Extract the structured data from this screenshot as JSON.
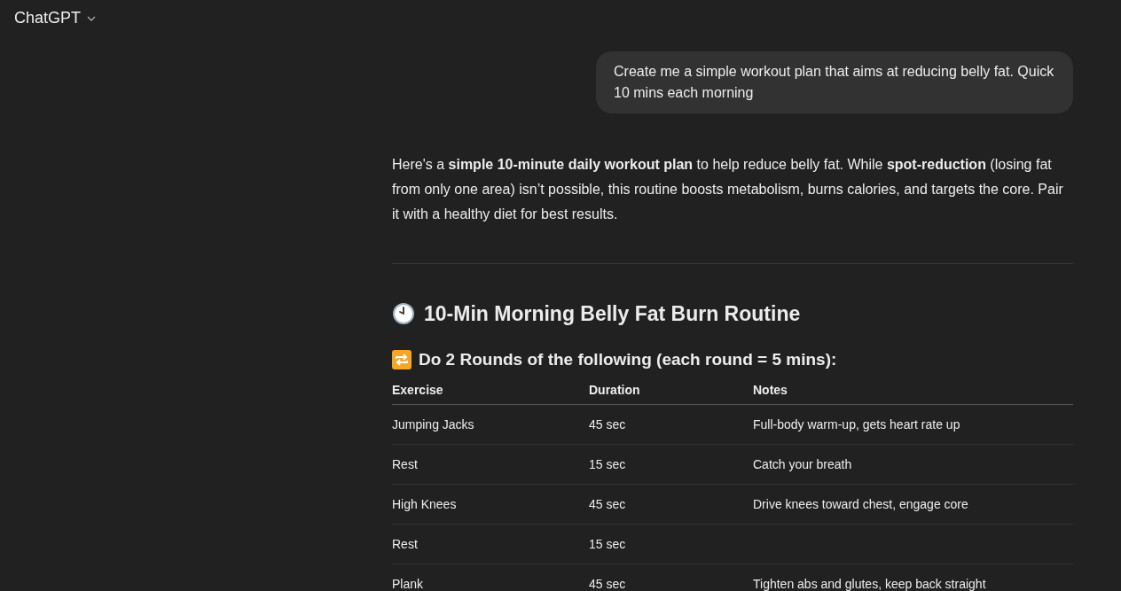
{
  "header": {
    "title": "ChatGPT"
  },
  "user_message": "Create me a simple workout plan that aims at reducing belly fat. Quick 10 mins each morning",
  "reply": {
    "intro": "Here's a **simple 10-minute daily workout plan** to help reduce belly fat. While **spot-reduction** (losing fat from only one area) isn’t possible, this routine boosts metabolism, burns calories, and targets the core. Pair it with a healthy diet for best results.",
    "heading": "10-Min Morning Belly Fat Burn Routine",
    "subheading": "Do 2 Rounds of the following (each round = 5 mins):",
    "table": {
      "columns": [
        "Exercise",
        "Duration",
        "Notes"
      ],
      "rows": [
        [
          "Jumping Jacks",
          "45 sec",
          "Full-body warm-up, gets heart rate up"
        ],
        [
          "Rest",
          "15 sec",
          "Catch your breath"
        ],
        [
          "High Knees",
          "45 sec",
          "Drive knees toward chest, engage core"
        ],
        [
          "Rest",
          "15 sec",
          ""
        ],
        [
          "Plank",
          "45 sec",
          "Tighten abs and glutes, keep back straight"
        ]
      ]
    }
  }
}
